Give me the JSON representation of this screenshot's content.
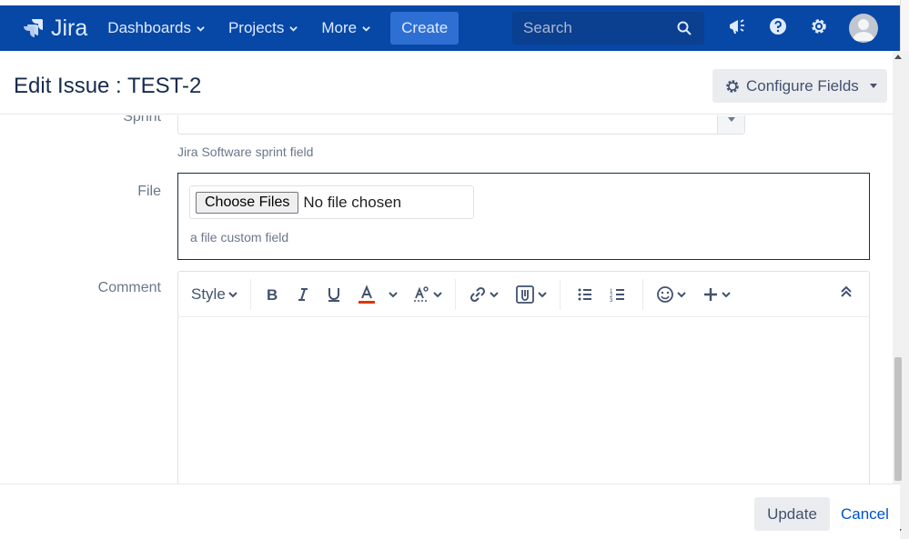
{
  "header": {
    "logo_text": "Jira",
    "nav": [
      {
        "label": "Dashboards"
      },
      {
        "label": "Projects"
      },
      {
        "label": "More"
      }
    ],
    "create_label": "Create",
    "search_placeholder": "Search",
    "icons": [
      "megaphone-icon",
      "help-icon",
      "gear-icon",
      "avatar"
    ],
    "bg_color": "#0747a6"
  },
  "dialog": {
    "title": "Edit Issue : TEST-2",
    "configure_fields_label": "Configure Fields"
  },
  "fields": {
    "sprint": {
      "label": "Sprint",
      "help": "Jira Software sprint field"
    },
    "file": {
      "label": "File",
      "choose_label": "Choose Files",
      "status": "No file chosen",
      "help": "a file custom field"
    },
    "comment": {
      "label": "Comment",
      "style_label": "Style"
    }
  },
  "toolbar_icons": [
    "bold-icon",
    "italic-icon",
    "underline-icon",
    "text-color-icon",
    "text-effects-icon",
    "link-icon",
    "attachment-icon",
    "bullet-list-icon",
    "numbered-list-icon",
    "emoji-icon",
    "insert-more-icon",
    "collapse-toolbar-icon"
  ],
  "footer": {
    "update_label": "Update",
    "cancel_label": "Cancel"
  }
}
